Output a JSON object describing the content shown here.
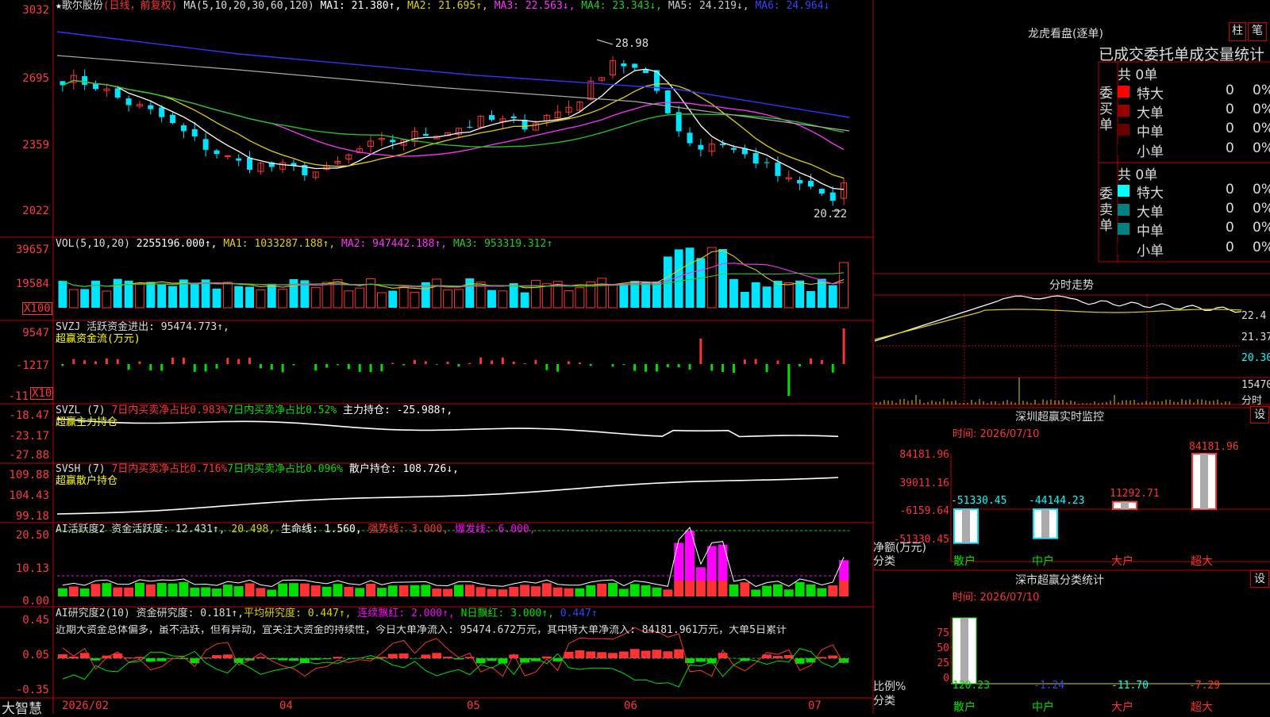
{
  "colors": {
    "up": "#ff3333",
    "down": "#00e5ff",
    "frame": "#c00000",
    "ma1": "#ffffff",
    "ma2": "#e0d000",
    "ma3": "#ff33ff",
    "ma4": "#22cc22",
    "ma5": "#aaaaaa",
    "ma6": "#3333ff",
    "green": "#00e000",
    "yellow": "#ffff00",
    "magenta": "#ff00ff"
  },
  "main": {
    "star": "★",
    "name": "歌尔股份",
    "mode": "(日线，前复权)",
    "ma_label": "MA(5,10,20,30,60,120)",
    "ma1": "MA1: 21.380↑,",
    "ma2": "MA2: 21.695↑,",
    "ma3": "MA3: 22.563↓,",
    "ma4": "MA4: 23.343↓,",
    "ma5": "MA5: 24.219↓,",
    "ma6": "MA6: 24.964↓",
    "ylabels": [
      "3032",
      "2695",
      "2359",
      "2022"
    ],
    "high_label": "28.98",
    "low_label": "20.22"
  },
  "vol": {
    "label": "VOL(5,10,20)",
    "value": "2255196.000↑,",
    "ma1": "MA1: 1033287.188↑,",
    "ma2": "MA2: 947442.188↑,",
    "ma3": "MA3: 953319.312↑",
    "ylabels": [
      "39657",
      "19584"
    ],
    "unit": "X100"
  },
  "svzj": {
    "label": "SVZJ  活跃资金进出: 95474.773↑,",
    "sub": "超赢资金流(万元)",
    "ylabels": [
      "9547",
      "-1217",
      "-11"
    ],
    "unit": "X10"
  },
  "svzl": {
    "label": "SVZL (7)",
    "a": "7日内买卖净占比0.983%",
    "b": "7日内买卖净占比0.52%",
    "c": "主力持仓: -25.988↑,",
    "sub": "超赢主力持仓",
    "ylabels": [
      "-18.47",
      "-23.17",
      "-27.88"
    ]
  },
  "svsh": {
    "label": "SVSH (7)",
    "a": "7日内买卖净占比0.716%",
    "b": "7日内买卖净占比0.096%",
    "c": "散户持仓: 108.726↓,",
    "sub": "超赢散户持仓",
    "ylabels": [
      "109.88",
      "104.43",
      "99.18"
    ]
  },
  "ai1": {
    "label": "AI活跃度2 资金活跃度: 12.431↑,",
    "v2": "20.498,",
    "life": "生命线: 1.560,",
    "strong": "强势线: 3.000,",
    "burst": "爆发线: 6.000,",
    "ylabels": [
      "20.50",
      "10.13",
      "0.00"
    ]
  },
  "ai2": {
    "label": "AI研究度2(10) 资金研究度: 0.181↑,",
    "avg": "平均研究度: 0.447↑,",
    "cont": "连续飘红: 2.000↑,",
    "nred": "N日飘红: 3.000↑,",
    "last": "0.447↑",
    "text": "近期大资金总体偏多，虽不活跃，但有异动，宜关注大资金的持续性，今日大单净流入: 95474.672万元，其中特大单净流入: 84181.961万元，大单5日累计",
    "ylabels": [
      "0.45",
      "0.05",
      "-0.35"
    ]
  },
  "bottom": {
    "brand": "大智慧",
    "dates": [
      "2026/02",
      "04",
      "05",
      "06",
      "07"
    ]
  },
  "right": {
    "dragon_title": "龙虎看盘(逐单)",
    "btn_zhu": "柱",
    "btn_bi": "笔",
    "table_title": "已成交委托单成交量统计",
    "buy_side": "委买单",
    "sell_side": "委卖单",
    "buy_total": "共 0单",
    "sell_total": "共 0单",
    "buy_rows": [
      {
        "name": "特大",
        "v": "0",
        "p": "0%",
        "color": "#ff0000"
      },
      {
        "name": "大单",
        "v": "0",
        "p": "0%",
        "color": "#990000"
      },
      {
        "name": "中单",
        "v": "0",
        "p": "0%",
        "color": "#660000"
      },
      {
        "name": "小单",
        "v": "0",
        "p": "0%",
        "color": "#000000"
      }
    ],
    "sell_rows": [
      {
        "name": "特大",
        "v": "0",
        "p": "0%",
        "color": "#00ffff"
      },
      {
        "name": "大单",
        "v": "0",
        "p": "0%",
        "color": "#008080"
      },
      {
        "name": "中单",
        "v": "0",
        "p": "0%",
        "color": "#008080"
      },
      {
        "name": "小单",
        "v": "0",
        "p": "0%",
        "color": "#000000"
      }
    ],
    "intraday_title": "分时走势",
    "intraday_ylabels": [
      "22.4",
      "21.37",
      "20.30"
    ],
    "intraday_vol": "15470",
    "intraday_unit": "分时",
    "monitor_title": "深圳超赢实时监控",
    "monitor_set": "设",
    "monitor_time": "时间: 2026/07/10",
    "monitor_ylabels": [
      "84181.96",
      "39011.16",
      "-6159.64",
      "-51330.45"
    ],
    "monitor_axis1": "净额(万元)",
    "monitor_axis2": "分类",
    "monitor_values": [
      "-51330.45",
      "-44144.23",
      "11292.71",
      "84181.96"
    ],
    "cats": [
      "散户",
      "中户",
      "大户",
      "超大"
    ],
    "stat_title": "深市超赢分类统计",
    "stat_set": "设",
    "stat_time": "时间: 2026/07/10",
    "stat_ylabels": [
      "75",
      "50",
      "25",
      "0"
    ],
    "stat_axis1": "比例%",
    "stat_axis2": "分类",
    "stat_values": [
      "120.23",
      "-1.24",
      "-11.70",
      "-7.29"
    ]
  },
  "chart_data": [
    {
      "type": "candlestick",
      "title": "歌尔股份(日线，前复权)",
      "ylim": [
        20.22,
        30.32
      ],
      "grid": false,
      "series": [
        {
          "name": "MA1",
          "value": 21.38
        },
        {
          "name": "MA2",
          "value": 21.695
        },
        {
          "name": "MA3",
          "value": 22.563
        },
        {
          "name": "MA4",
          "value": 23.343
        },
        {
          "name": "MA5",
          "value": 24.219
        },
        {
          "name": "MA6",
          "value": 24.964
        }
      ],
      "annotations": [
        {
          "label": "28.98"
        },
        {
          "label": "20.22"
        }
      ]
    },
    {
      "type": "bar",
      "title": "深圳超赢实时监控",
      "categories": [
        "散户",
        "中户",
        "大户",
        "超大"
      ],
      "values": [
        -51330.45,
        -44144.23,
        11292.71,
        84181.96
      ],
      "ylabel": "净额(万元)",
      "ylim": [
        -51330.45,
        84181.96
      ]
    },
    {
      "type": "bar",
      "title": "深市超赢分类统计",
      "categories": [
        "散户",
        "中户",
        "大户",
        "超大"
      ],
      "values": [
        120.23,
        -1.24,
        -11.7,
        -7.29
      ],
      "ylabel": "比例%",
      "ylim": [
        0,
        75
      ]
    }
  ]
}
